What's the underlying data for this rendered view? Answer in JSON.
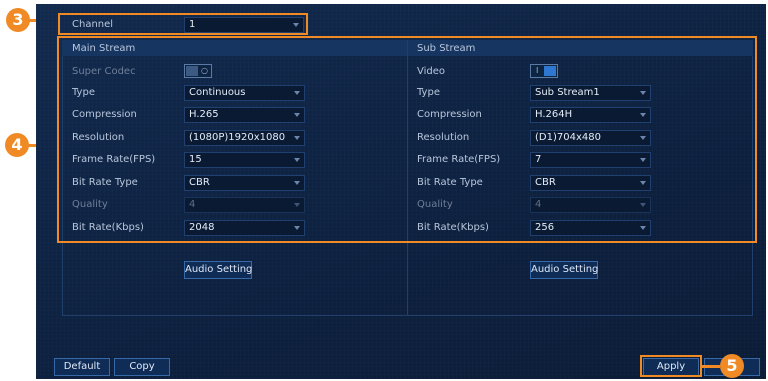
{
  "channel": {
    "label": "Channel",
    "value": "1"
  },
  "main_stream": {
    "title": "Main Stream",
    "super_codec_label": "Super Codec",
    "rows": [
      {
        "label": "Type",
        "value": "Continuous"
      },
      {
        "label": "Compression",
        "value": "H.265"
      },
      {
        "label": "Resolution",
        "value": "(1080P)1920x1080"
      },
      {
        "label": "Frame Rate(FPS)",
        "value": "15"
      },
      {
        "label": "Bit Rate Type",
        "value": "CBR"
      },
      {
        "label": "Quality",
        "value": "4"
      },
      {
        "label": "Bit Rate(Kbps)",
        "value": "2048"
      }
    ],
    "audio_button": "Audio Setting"
  },
  "sub_stream": {
    "title": "Sub Stream",
    "video_label": "Video",
    "rows": [
      {
        "label": "Type",
        "value": "Sub Stream1"
      },
      {
        "label": "Compression",
        "value": "H.264H"
      },
      {
        "label": "Resolution",
        "value": "(D1)704x480"
      },
      {
        "label": "Frame Rate(FPS)",
        "value": "7"
      },
      {
        "label": "Bit Rate Type",
        "value": "CBR"
      },
      {
        "label": "Quality",
        "value": "4"
      },
      {
        "label": "Bit Rate(Kbps)",
        "value": "256"
      }
    ],
    "audio_button": "Audio Setting"
  },
  "buttons": {
    "default": "Default",
    "copy": "Copy",
    "apply": "Apply"
  },
  "callouts": [
    "3",
    "4",
    "5"
  ],
  "colors": {
    "accent": "#f08a24",
    "background": "#0d2140",
    "toggle_on": "#2f78d2"
  },
  "toggles": {
    "super_codec": false,
    "video": true
  }
}
